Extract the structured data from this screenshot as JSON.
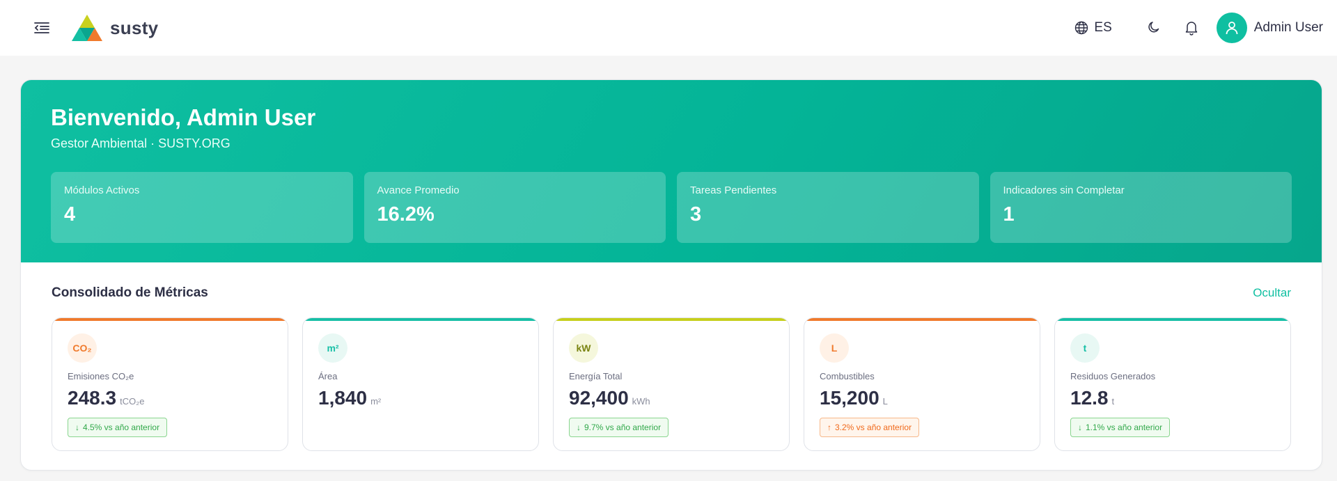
{
  "header": {
    "brand": "susty",
    "language": "ES",
    "user_name": "Admin User"
  },
  "hero": {
    "title": "Bienvenido, Admin User",
    "subtitle": "Gestor Ambiental · SUSTY.ORG",
    "stats": [
      {
        "label": "Módulos Activos",
        "value": "4"
      },
      {
        "label": "Avance Promedio",
        "value": "16.2%"
      },
      {
        "label": "Tareas Pendientes",
        "value": "3"
      },
      {
        "label": "Indicadores sin Completar",
        "value": "1"
      }
    ]
  },
  "metrics": {
    "title": "Consolidado de Métricas",
    "hide_label": "Ocultar",
    "cards": [
      {
        "icon": "CO₂",
        "label": "Emisiones CO₂e",
        "value": "248.3",
        "unit": "tCO₂e",
        "badge": "4.5% vs año anterior",
        "trend": "down",
        "accent": "#f07a2c",
        "icon_bg": "#fff1e6",
        "icon_color": "#f07a2c"
      },
      {
        "icon": "m²",
        "label": "Área",
        "value": "1,840",
        "unit": "m²",
        "badge": "",
        "trend": "",
        "accent": "#17bfa6",
        "icon_bg": "#e8f8f4",
        "icon_color": "#17bfa6"
      },
      {
        "icon": "kW",
        "label": "Energía Total",
        "value": "92,400",
        "unit": "kWh",
        "badge": "9.7% vs año anterior",
        "trend": "down",
        "accent": "#c6cf1c",
        "icon_bg": "#f5f7dc",
        "icon_color": "#7a8412"
      },
      {
        "icon": "L",
        "label": "Combustibles",
        "value": "15,200",
        "unit": "L",
        "badge": "3.2% vs año anterior",
        "trend": "up",
        "accent": "#f07a2c",
        "icon_bg": "#fff1e6",
        "icon_color": "#f07a2c"
      },
      {
        "icon": "t",
        "label": "Residuos Generados",
        "value": "12.8",
        "unit": "t",
        "badge": "1.1% vs año anterior",
        "trend": "down",
        "accent": "#17bfa6",
        "icon_bg": "#e8f8f4",
        "icon_color": "#17bfa6"
      }
    ]
  },
  "colors": {
    "brand_teal": "#0fbfa1",
    "trend_down": "#31a84a",
    "trend_up": "#f06a1c"
  }
}
